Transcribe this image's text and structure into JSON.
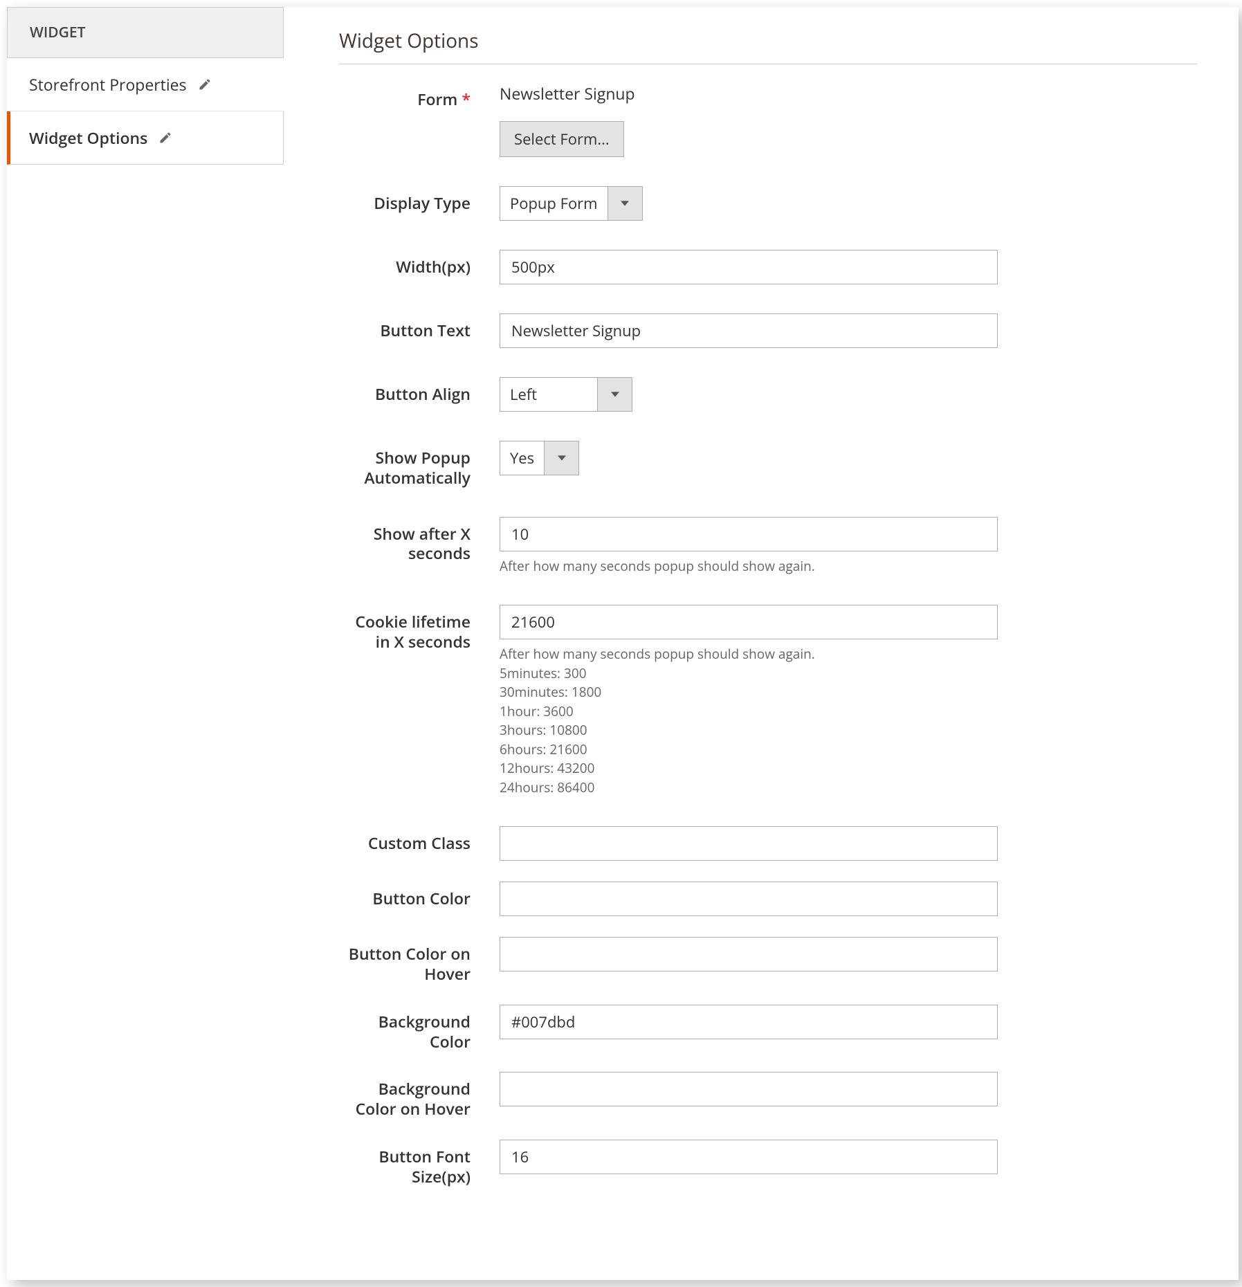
{
  "sidebar": {
    "header": "WIDGET",
    "tabs": [
      {
        "label": "Storefront Properties"
      },
      {
        "label": "Widget Options"
      }
    ]
  },
  "section": {
    "title": "Widget Options"
  },
  "fields": {
    "form": {
      "label": "Form",
      "value": "Newsletter Signup",
      "button": "Select Form..."
    },
    "display_type": {
      "label": "Display Type",
      "value": "Popup Form"
    },
    "width": {
      "label": "Width(px)",
      "value": "500px"
    },
    "button_text": {
      "label": "Button Text",
      "value": "Newsletter Signup"
    },
    "button_align": {
      "label": "Button Align",
      "value": "Left"
    },
    "show_popup": {
      "label": "Show Popup Automatically",
      "value": "Yes"
    },
    "show_after": {
      "label": "Show after X seconds",
      "value": "10",
      "help": "After how many seconds popup should show again."
    },
    "cookie_lifetime": {
      "label": "Cookie lifetime in X seconds",
      "value": "21600",
      "help_lines": [
        "After how many seconds popup should show again.",
        "5minutes: 300",
        "30minutes: 1800",
        "1hour: 3600",
        "3hours: 10800",
        "6hours: 21600",
        "12hours: 43200",
        "24hours: 86400"
      ]
    },
    "custom_class": {
      "label": "Custom Class",
      "value": ""
    },
    "button_color": {
      "label": "Button Color",
      "value": ""
    },
    "button_color_hover": {
      "label": "Button Color on Hover",
      "value": ""
    },
    "bg_color": {
      "label": "Background Color",
      "value": "#007dbd"
    },
    "bg_color_hover": {
      "label": "Background Color on Hover",
      "value": ""
    },
    "button_font_size": {
      "label": "Button Font Size(px)",
      "value": "16"
    }
  }
}
